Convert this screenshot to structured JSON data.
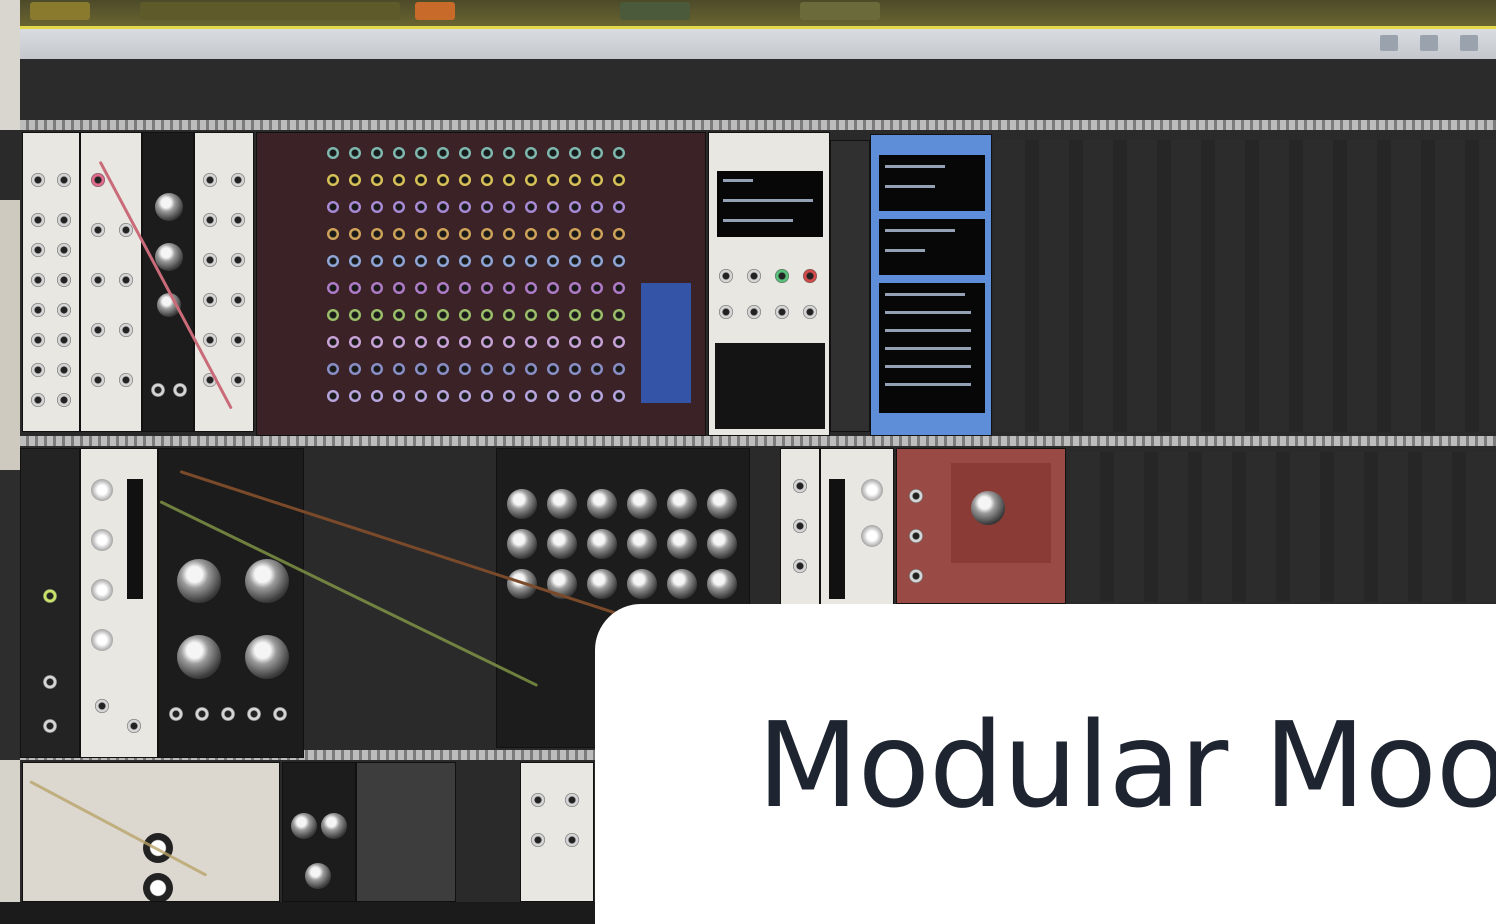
{
  "title": "Modular Moo",
  "colors": {
    "card_background": "#ffffff",
    "title_text": "#1f2530",
    "rack_background": "#2a2a2a",
    "top_bar_accent": "#e3d84a"
  },
  "icons": [
    "patch-jack",
    "knob",
    "module-screen",
    "patch-cable",
    "rack-rail"
  ]
}
